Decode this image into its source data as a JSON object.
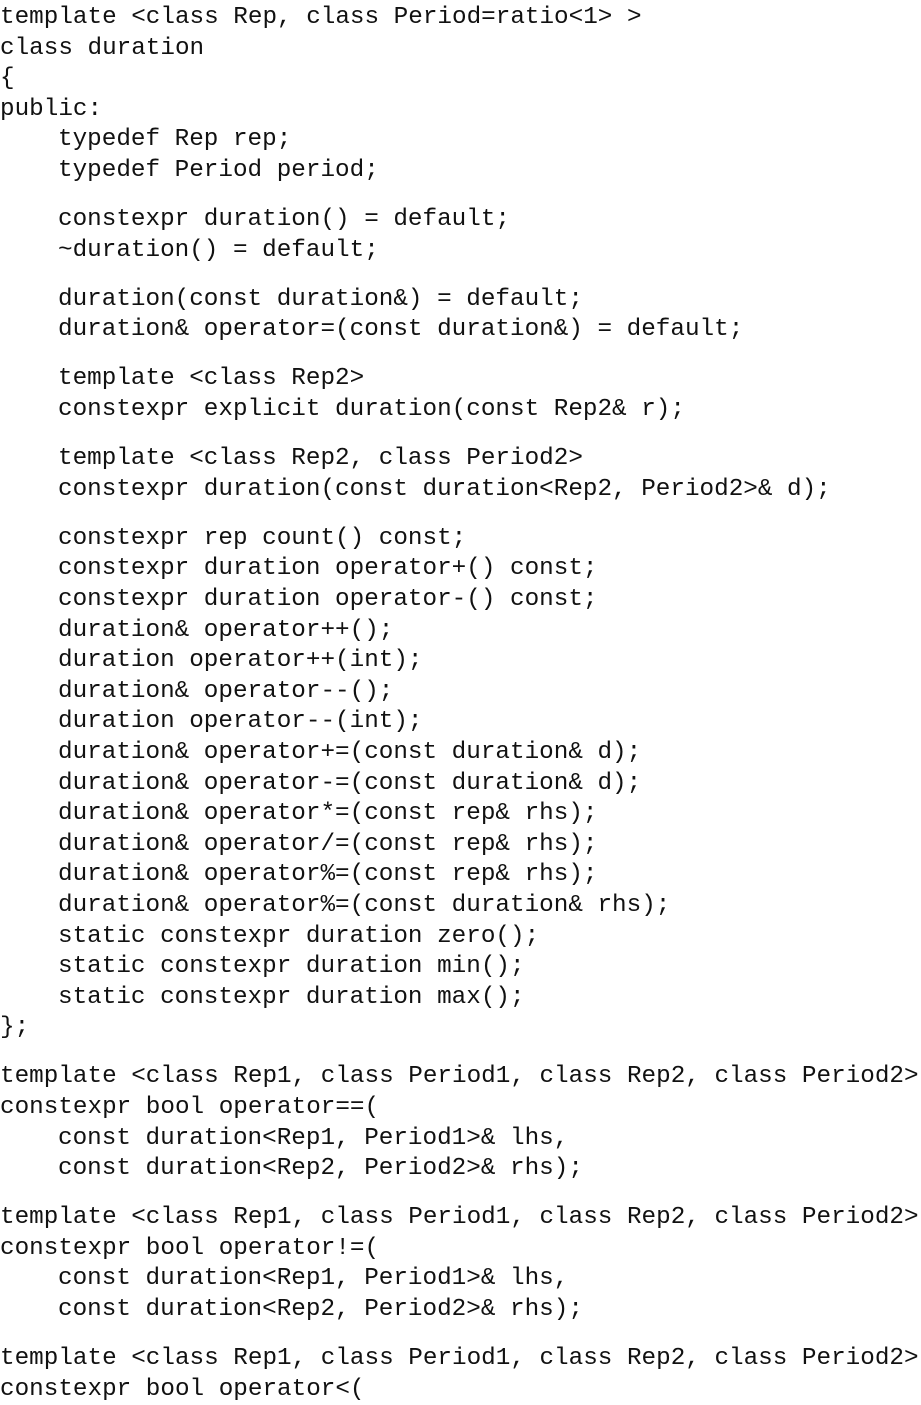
{
  "code_lines": [
    {
      "text": "template <class Rep, class Period=ratio<1> >",
      "indent": 0,
      "gap_before": false
    },
    {
      "text": "class duration",
      "indent": 0,
      "gap_before": false
    },
    {
      "text": "{",
      "indent": 0,
      "gap_before": false
    },
    {
      "text": "public:",
      "indent": 0,
      "gap_before": false
    },
    {
      "text": "typedef Rep rep;",
      "indent": 1,
      "gap_before": false
    },
    {
      "text": "typedef Period period;",
      "indent": 1,
      "gap_before": false
    },
    {
      "text": "constexpr duration() = default;",
      "indent": 1,
      "gap_before": true
    },
    {
      "text": "~duration() = default;",
      "indent": 1,
      "gap_before": false
    },
    {
      "text": "duration(const duration&) = default;",
      "indent": 1,
      "gap_before": true
    },
    {
      "text": "duration& operator=(const duration&) = default;",
      "indent": 1,
      "gap_before": false
    },
    {
      "text": "template <class Rep2>",
      "indent": 1,
      "gap_before": true
    },
    {
      "text": "constexpr explicit duration(const Rep2& r);",
      "indent": 1,
      "gap_before": false
    },
    {
      "text": "template <class Rep2, class Period2>",
      "indent": 1,
      "gap_before": true
    },
    {
      "text": "constexpr duration(const duration<Rep2, Period2>& d);",
      "indent": 1,
      "gap_before": false
    },
    {
      "text": "constexpr rep count() const;",
      "indent": 1,
      "gap_before": true
    },
    {
      "text": "constexpr duration operator+() const;",
      "indent": 1,
      "gap_before": false
    },
    {
      "text": "constexpr duration operator-() const;",
      "indent": 1,
      "gap_before": false
    },
    {
      "text": "duration& operator++();",
      "indent": 1,
      "gap_before": false
    },
    {
      "text": "duration operator++(int);",
      "indent": 1,
      "gap_before": false
    },
    {
      "text": "duration& operator--();",
      "indent": 1,
      "gap_before": false
    },
    {
      "text": "duration operator--(int);",
      "indent": 1,
      "gap_before": false
    },
    {
      "text": "duration& operator+=(const duration& d);",
      "indent": 1,
      "gap_before": false
    },
    {
      "text": "duration& operator-=(const duration& d);",
      "indent": 1,
      "gap_before": false
    },
    {
      "text": "duration& operator*=(const rep& rhs);",
      "indent": 1,
      "gap_before": false
    },
    {
      "text": "duration& operator/=(const rep& rhs);",
      "indent": 1,
      "gap_before": false
    },
    {
      "text": "duration& operator%=(const rep& rhs);",
      "indent": 1,
      "gap_before": false
    },
    {
      "text": "duration& operator%=(const duration& rhs);",
      "indent": 1,
      "gap_before": false
    },
    {
      "text": "static constexpr duration zero();",
      "indent": 1,
      "gap_before": false
    },
    {
      "text": "static constexpr duration min();",
      "indent": 1,
      "gap_before": false
    },
    {
      "text": "static constexpr duration max();",
      "indent": 1,
      "gap_before": false
    },
    {
      "text": "};",
      "indent": 0,
      "gap_before": false
    },
    {
      "text": "template <class Rep1, class Period1, class Rep2, class Period2>",
      "indent": 0,
      "gap_before": true
    },
    {
      "text": "constexpr bool operator==(",
      "indent": 0,
      "gap_before": false
    },
    {
      "text": "const duration<Rep1, Period1>& lhs,",
      "indent": 1,
      "gap_before": false
    },
    {
      "text": "const duration<Rep2, Period2>& rhs);",
      "indent": 1,
      "gap_before": false
    },
    {
      "text": "template <class Rep1, class Period1, class Rep2, class Period2>",
      "indent": 0,
      "gap_before": true
    },
    {
      "text": "constexpr bool operator!=(",
      "indent": 0,
      "gap_before": false
    },
    {
      "text": "const duration<Rep1, Period1>& lhs,",
      "indent": 1,
      "gap_before": false
    },
    {
      "text": "const duration<Rep2, Period2>& rhs);",
      "indent": 1,
      "gap_before": false
    },
    {
      "text": "template <class Rep1, class Period1, class Rep2, class Period2>",
      "indent": 0,
      "gap_before": true
    },
    {
      "text": "constexpr bool operator<(",
      "indent": 0,
      "gap_before": false
    }
  ]
}
